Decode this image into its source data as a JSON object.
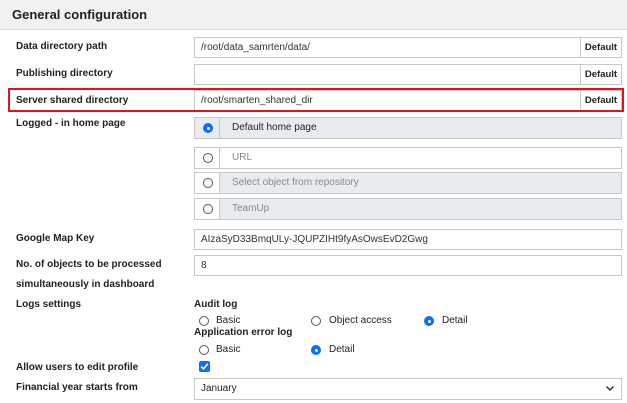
{
  "header": {
    "title": "General configuration"
  },
  "fields": {
    "data_dir": {
      "label": "Data directory path",
      "value": "/root/data_samrten/data/",
      "default": "Default"
    },
    "publishing_dir": {
      "label": "Publishing directory",
      "value": "",
      "default": "Default"
    },
    "server_shared_dir": {
      "label": "Server shared directory",
      "value": "/root/smarten_shared_dir",
      "default": "Default"
    }
  },
  "home_page": {
    "label": "Logged - in home page",
    "options": [
      {
        "label": "Default home page",
        "selected": true
      },
      {
        "label": "URL",
        "selected": false
      },
      {
        "label": "Select object from repository",
        "selected": false
      },
      {
        "label": "TeamUp",
        "selected": false
      }
    ]
  },
  "google_map": {
    "label": "Google Map Key",
    "value": "AIzaSyD33BmqULy-JQUPZIHt9fyAsOwsEvD2Gwg"
  },
  "objects_count": {
    "label_line1": "No. of objects to be processed",
    "label_line2": "simultaneously in dashboard",
    "value": "8"
  },
  "logs": {
    "label": "Logs settings",
    "audit_title": "Audit log",
    "audit_options": [
      "Basic",
      "Object access",
      "Detail"
    ],
    "audit_selected": "Detail",
    "app_title": "Application error log",
    "app_options": [
      "Basic",
      "Detail"
    ],
    "app_selected": "Detail"
  },
  "edit_profile": {
    "label": "Allow users to edit profile",
    "checked": true
  },
  "financial_year": {
    "label": "Financial year starts from",
    "value": "January"
  },
  "colors": {
    "accent": "#0d6efd",
    "highlight": "#e0141e"
  }
}
